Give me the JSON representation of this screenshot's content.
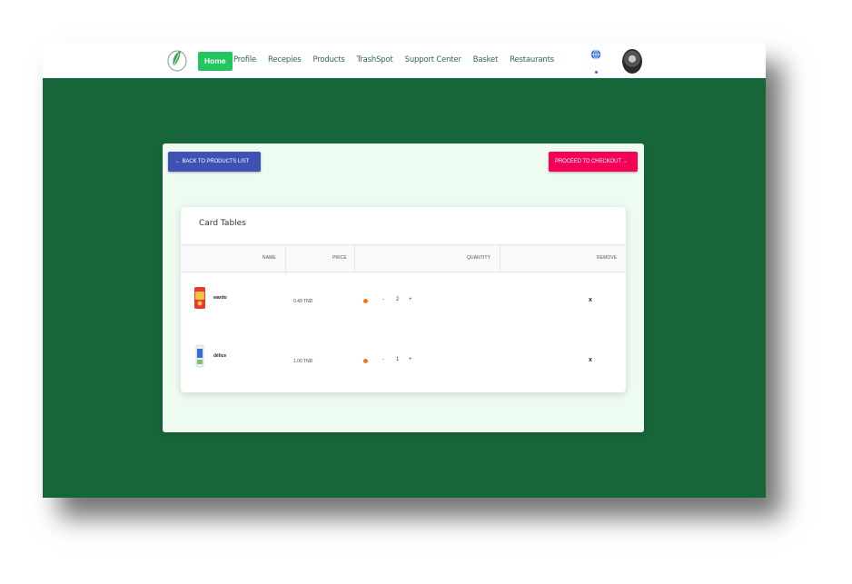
{
  "nav": {
    "home": "Home",
    "links": [
      "Profile",
      "Recepies",
      "Products",
      "TrashSpot",
      "Support Center",
      "Basket",
      "Restaurants"
    ]
  },
  "actions": {
    "back_label": "← BACK TO PRODUCTS LIST",
    "checkout_label": "PROCEED TO CHECKOUT →"
  },
  "card": {
    "title": "Card Tables",
    "columns": [
      "NAME",
      "PRICE",
      "QUANTITY",
      "REMOVE"
    ],
    "rows": [
      {
        "name": "wardo",
        "price": "0.49 TND",
        "minus": "-",
        "qty": "2",
        "plus": "+",
        "remove": "x"
      },
      {
        "name": "délice",
        "price": "1.00 TND",
        "minus": "-",
        "qty": "1",
        "plus": "+",
        "remove": "x"
      }
    ]
  },
  "colors": {
    "background": "#17663a",
    "home_button": "#22c55e",
    "back_button": "#3f51b5",
    "checkout_button": "#f50057",
    "panel": "#eefbf1",
    "qty_dot": "#f97316"
  },
  "icons": [
    "leaf-logo-icon",
    "globe-icon",
    "user-avatar"
  ]
}
